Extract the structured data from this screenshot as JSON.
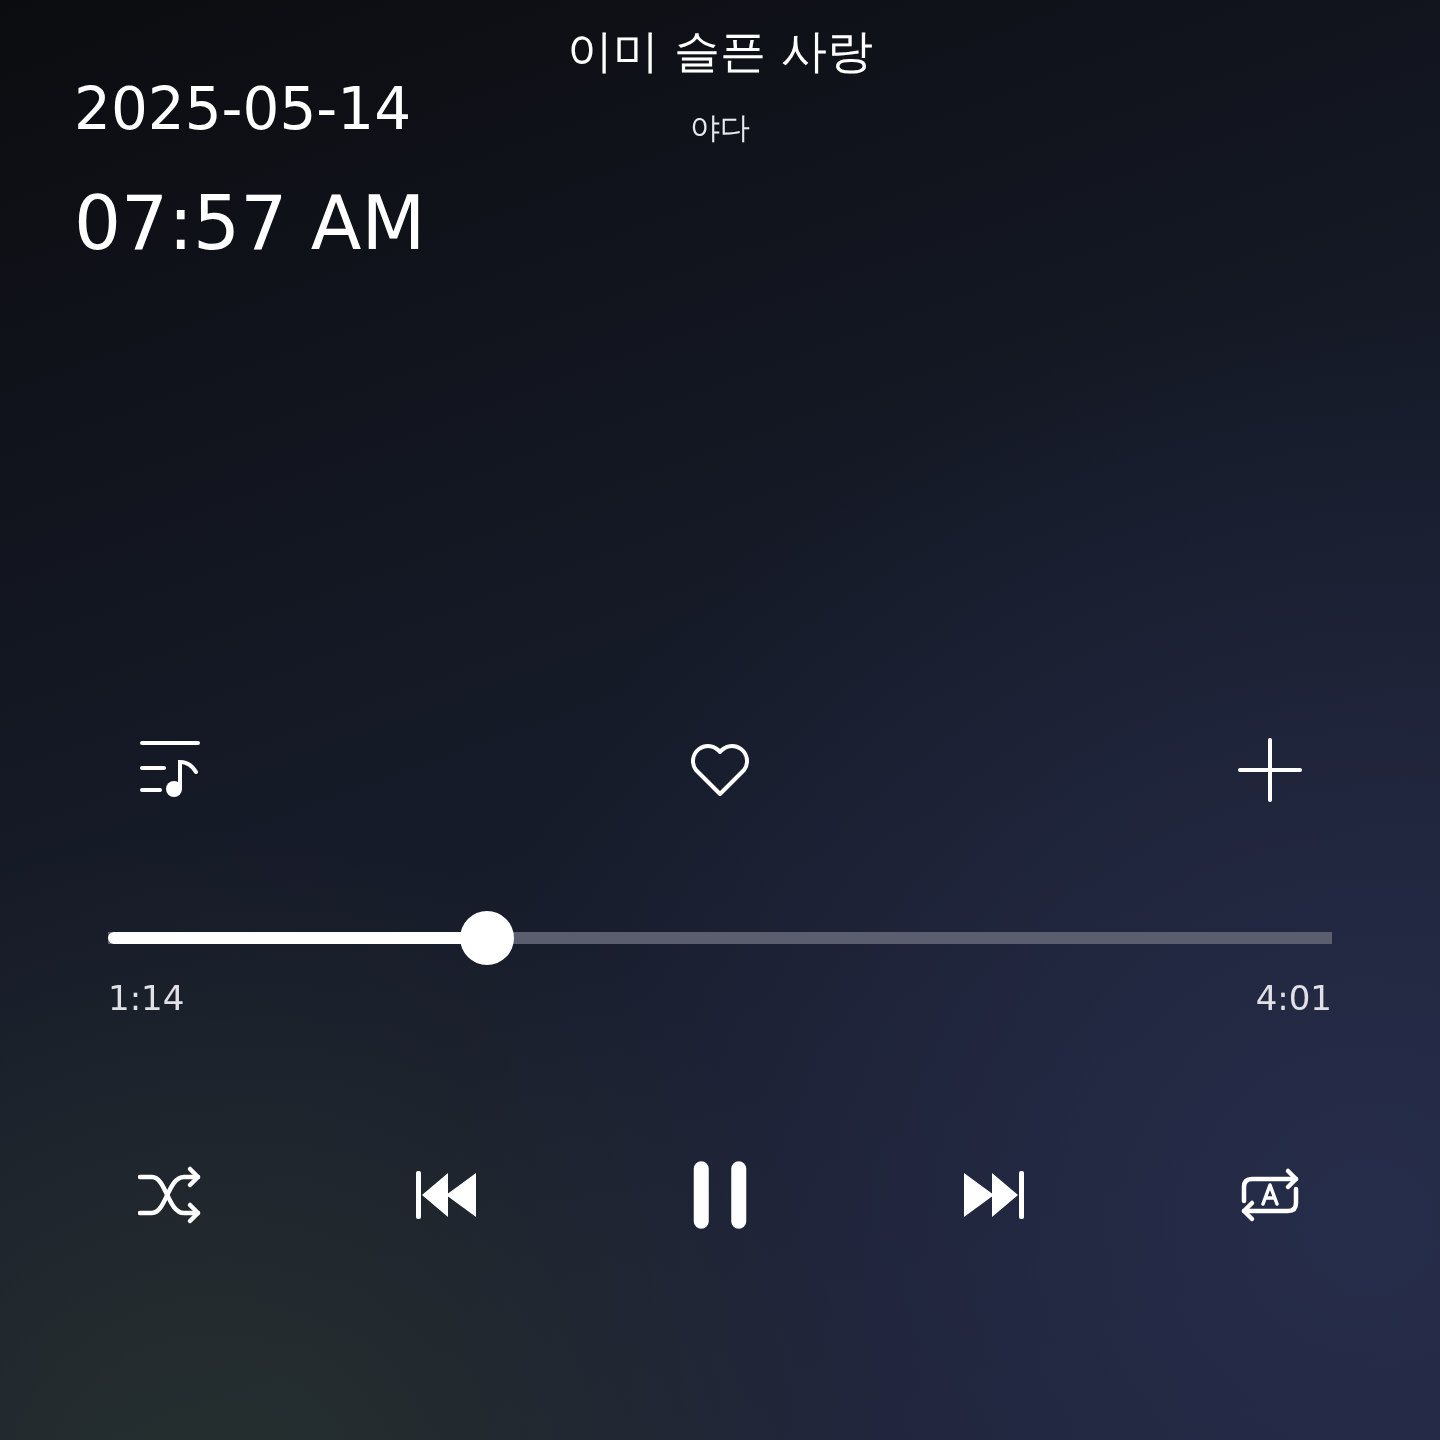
{
  "timestamp": {
    "date": "2025-05-14",
    "time": "07:57 AM"
  },
  "track": {
    "title": "이미 슬픈 사랑",
    "artist": "야다"
  },
  "actions": {
    "liked": false
  },
  "progress": {
    "level": 0.31,
    "elapsed": "1:14",
    "duration": "4:01"
  },
  "playback": {
    "playing": true
  }
}
